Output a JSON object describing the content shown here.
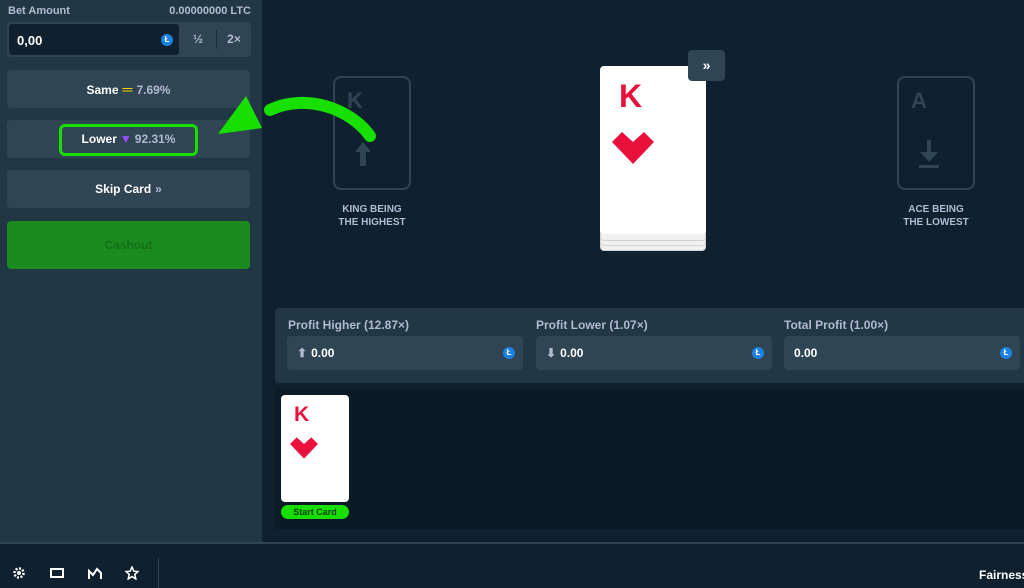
{
  "sidebar": {
    "bet_amount_label": "Bet Amount",
    "bet_amount_crypto": "0.00000000 LTC",
    "bet_input_value": "0,00",
    "half_label": "½",
    "double_label": "2×",
    "same_label": "Same",
    "same_pct": "7.69%",
    "lower_label": "Lower",
    "lower_pct": "92.31%",
    "skip_label": "Skip Card",
    "cashout_label": "Cashout"
  },
  "game": {
    "slot_high_rank": "K",
    "slot_high_caption": "KING BEING\nTHE HIGHEST",
    "slot_low_rank": "A",
    "slot_low_caption": "ACE BEING\nTHE LOWEST",
    "current_card_rank": "K",
    "current_card_suit": "hearts",
    "skip_top_label": "»"
  },
  "profit": {
    "higher_label": "Profit Higher (12.87×)",
    "higher_value": "0.00",
    "lower_label": "Profit Lower (1.07×)",
    "lower_value": "0.00",
    "total_label": "Total Profit (1.00×)",
    "total_value": "0.00"
  },
  "history": {
    "card_rank": "K",
    "card_suit": "hearts",
    "card_caption": "Start Card"
  },
  "bottom_bar": {
    "icons": [
      "gear-icon",
      "theatre-mode-icon",
      "stats-icon",
      "star-icon"
    ],
    "fairness_label": "Fairness"
  },
  "colors": {
    "highlight": "#17e000",
    "card_red": "#e9113c",
    "cashout": "#1b8b1f"
  }
}
